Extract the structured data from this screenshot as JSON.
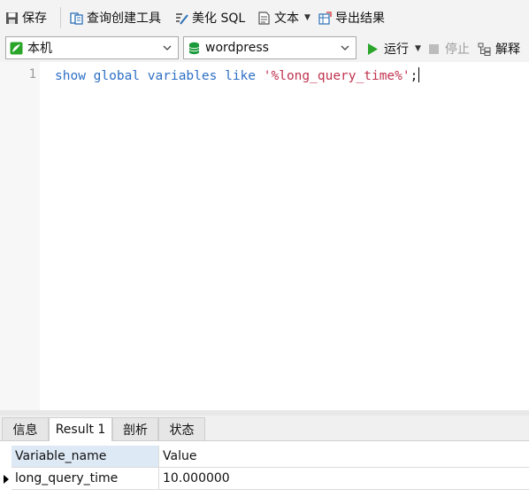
{
  "toolbar": {
    "save_label": "保存",
    "query_builder_label": "查询创建工具",
    "beautify_label": "美化 SQL",
    "text_label": "文本",
    "export_label": "导出结果"
  },
  "connection_bar": {
    "connection_value": "本机",
    "database_value": "wordpress",
    "run_label": "运行",
    "stop_label": "停止",
    "explain_label": "解释"
  },
  "editor": {
    "line_numbers": [
      "1"
    ],
    "tokens": {
      "t1": "show",
      "t2": "global",
      "t3": "variables",
      "t4": "like",
      "t5": "'%long_query_time%'",
      "t6": ";"
    }
  },
  "result_tabs": [
    {
      "label": "信息"
    },
    {
      "label": "Result 1"
    },
    {
      "label": "剖析"
    },
    {
      "label": "状态"
    }
  ],
  "result_grid": {
    "columns": [
      "Variable_name",
      "Value"
    ],
    "rows": [
      [
        "long_query_time",
        "10.000000"
      ]
    ]
  },
  "colors": {
    "keyword": "#2e6fc4",
    "string": "#c0334f",
    "run_green": "#2aa52a",
    "db_green": "#1a9a3a"
  }
}
